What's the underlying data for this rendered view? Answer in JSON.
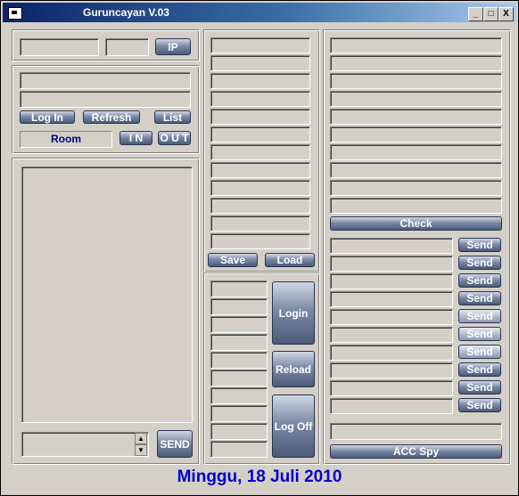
{
  "window": {
    "title": "Guruncayan V.03",
    "controls": [
      "_",
      "□",
      "X"
    ]
  },
  "top_left": {
    "ip_button": "IP"
  },
  "login_box": {
    "login_button": "Log In",
    "refresh_button": "Refresh",
    "list_button": "List",
    "room_label": "Room",
    "in_button": "I N",
    "out_button": "O U T"
  },
  "chat": {
    "send_button": "SEND"
  },
  "middle": {
    "save_button": "Save",
    "load_button": "Load",
    "login_button": "Login",
    "reload_button": "Reload",
    "logoff_button": "Log Off"
  },
  "right": {
    "check_button": "Check",
    "send_buttons": [
      "Send",
      "Send",
      "Send",
      "Send",
      "Send",
      "Send",
      "Send",
      "Send",
      "Send",
      "Send"
    ],
    "acc_spy_button": "ACC Spy"
  },
  "status_text": "Minggu, 18 Juli 2010"
}
